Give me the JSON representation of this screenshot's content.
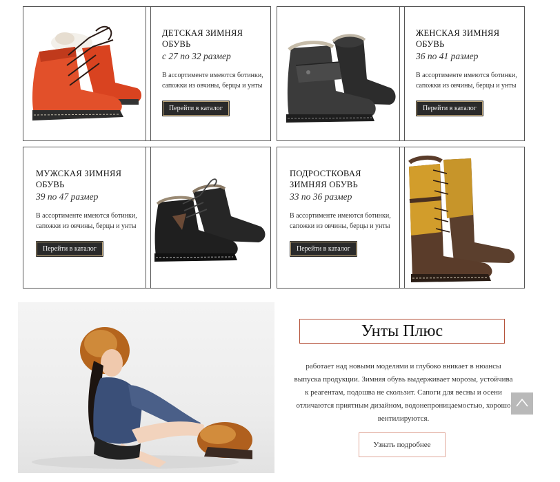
{
  "cards": [
    {
      "title": "ДЕТСКАЯ ЗИМНЯЯ ОБУВЬ",
      "size": "с 27 по 32 размер",
      "description": "В ассортименте имеются ботинки, сапожки из овчины, берцы и унты",
      "button": "Перейти в каталог",
      "image_icon": "orange-kids-boot"
    },
    {
      "title": "ЖЕНСКАЯ ЗИМНЯЯ ОБУВЬ",
      "size": "36 по 41 размер",
      "description": "В ассортименте имеются ботинки, сапожки из овчины, берцы и унты",
      "button": "Перейти в каталог",
      "image_icon": "black-womens-boot"
    },
    {
      "title": "МУЖСКАЯ ЗИМНЯЯ ОБУВЬ",
      "size": "39 по 47 размер",
      "description": "В ассортименте имеются ботинки, сапожки из овчины, берцы и унты",
      "button": "Перейти в каталог",
      "image_icon": "black-mens-boot"
    },
    {
      "title": "ПОДРОСТКОВАЯ ЗИМНЯЯ ОБУВЬ",
      "size": "33 по 36 размер",
      "description": "В ассортименте имеются ботинки, сапожки из овчины, берцы и унты",
      "button": "Перейти в каталог",
      "image_icon": "mustard-teen-boot"
    }
  ],
  "about": {
    "brand": "Унты Плюс",
    "text": "работает над новыми моделями и глубоко вникает в нюансы выпуска продукции. Зимняя обувь выдерживает морозы, устойчива к реагентам, подошва не скользит. Сапоги для весны и осени отличаются приятным дизайном, водонепроницаемостью, хорошо вентилируются.",
    "button": "Узнать подробнее",
    "photo_icon": "woman-in-fur-hat-photo"
  },
  "scroll_top_icon": "chevron-up-icon",
  "colors": {
    "button_dark": "#2a2a2a",
    "accent_border": "#b5533b",
    "scroll_button": "#b9b9b9"
  }
}
